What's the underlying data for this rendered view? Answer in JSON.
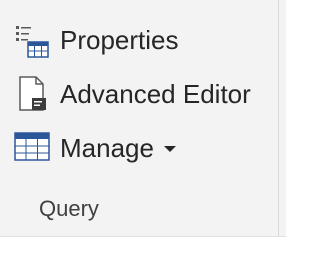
{
  "ribbon_group": {
    "name": "Query",
    "commands": {
      "properties": {
        "label": "Properties",
        "icon": "properties-icon"
      },
      "advanced_editor": {
        "label": "Advanced Editor",
        "icon": "advanced-editor-icon"
      },
      "manage": {
        "label": "Manage",
        "icon": "table-grid-icon",
        "has_dropdown": true
      }
    }
  },
  "colors": {
    "ribbon_background": "#f3f3f3",
    "text": "#262626",
    "icon_blue": "#2b579a",
    "icon_gray": "#5a5a5a"
  }
}
